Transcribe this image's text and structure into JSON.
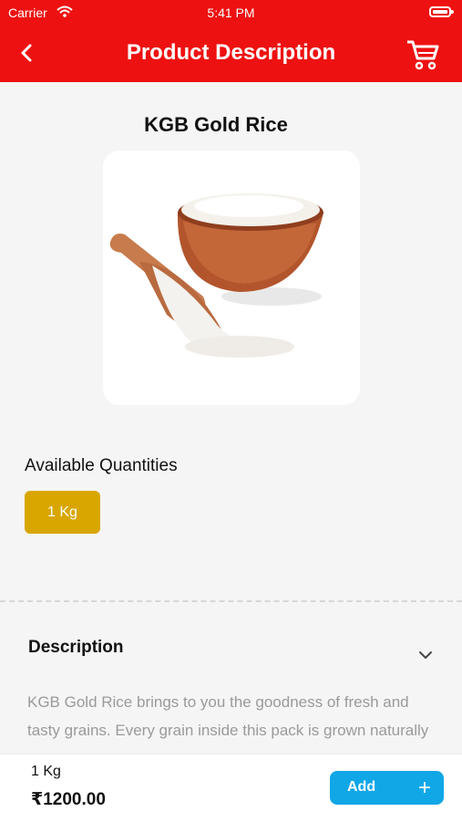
{
  "status_bar": {
    "carrier": "Carrier",
    "time": "5:41 PM"
  },
  "header": {
    "title": "Product Description",
    "back_icon": "chevron-left-icon",
    "cart_icon": "cart-icon",
    "color": "#ee1111"
  },
  "product": {
    "name": "KGB Gold Rice",
    "image_alt": "rice-bowl-image"
  },
  "quantities": {
    "label": "Available Quantities",
    "options": [
      "1 Kg"
    ],
    "selected_color": "#d9a600"
  },
  "description": {
    "heading": "Description",
    "text": "KGB Gold Rice brings to you the goodness of fresh and tasty grains. Every grain inside this pack is grown naturally"
  },
  "bottom_bar": {
    "quantity": "1 Kg",
    "price": "₹1200.00",
    "add_label": "Add",
    "add_color": "#11a7e7"
  }
}
